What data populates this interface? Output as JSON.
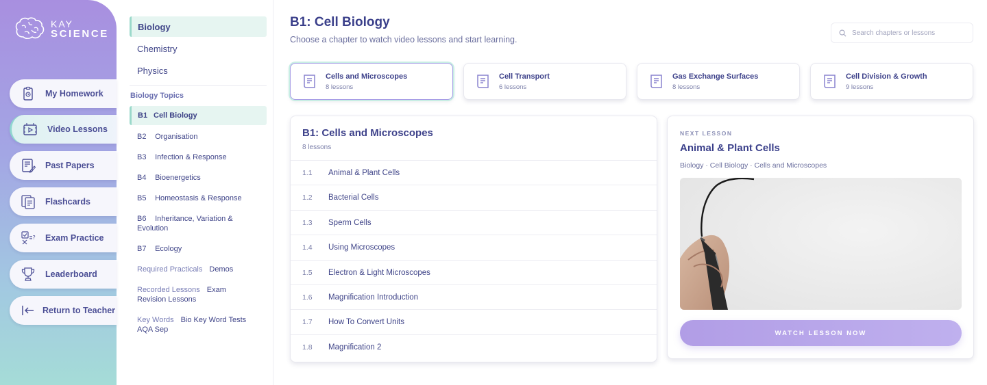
{
  "brand": {
    "line1": "KAY",
    "line2": "SCIENCE"
  },
  "nav": [
    {
      "label": "My Homework",
      "icon": "homework-icon"
    },
    {
      "label": "Video Lessons",
      "icon": "video-lessons-icon"
    },
    {
      "label": "Past Papers",
      "icon": "past-papers-icon"
    },
    {
      "label": "Flashcards",
      "icon": "flashcards-icon"
    },
    {
      "label": "Exam Practice",
      "icon": "exam-practice-icon"
    },
    {
      "label": "Leaderboard",
      "icon": "trophy-icon"
    },
    {
      "label": "Return to Teacher",
      "icon": "return-arrow-icon"
    }
  ],
  "nav_active": "Video Lessons",
  "subjects": [
    "Biology",
    "Chemistry",
    "Physics"
  ],
  "subject_active": "Biology",
  "topics_title": "Biology Topics",
  "topics": [
    {
      "code": "B1",
      "label": "Cell Biology"
    },
    {
      "code": "B2",
      "label": "Organisation"
    },
    {
      "code": "B3",
      "label": "Infection & Response"
    },
    {
      "code": "B4",
      "label": "Bioenergetics"
    },
    {
      "code": "B5",
      "label": "Homeostasis & Response"
    },
    {
      "code": "B6",
      "label": "Inheritance, Variation & Evolution"
    },
    {
      "code": "B7",
      "label": "Ecology"
    }
  ],
  "extra_links": [
    {
      "prefix": "Required Practicals",
      "label": "Demos"
    },
    {
      "prefix": "Recorded Lessons",
      "label": "Exam Revision Lessons"
    },
    {
      "prefix": "Key Words",
      "label": "Bio Key Word Tests AQA Sep"
    }
  ],
  "main": {
    "title": "B1: Cell Biology",
    "subtitle": "Choose a chapter to watch video lessons and start learning.",
    "search_placeholder": "Search chapters or lessons"
  },
  "chapters": [
    {
      "title": "Cells and Microscopes",
      "count": "8 lessons"
    },
    {
      "title": "Cell Transport",
      "count": "6 lessons"
    },
    {
      "title": "Gas Exchange Surfaces",
      "count": "8 lessons"
    },
    {
      "title": "Cell Division & Growth",
      "count": "9 lessons"
    }
  ],
  "lesson_list": {
    "title": "B1: Cells and Microscopes",
    "count": "8 lessons",
    "lessons": [
      {
        "num": "1.1",
        "title": "Animal & Plant Cells"
      },
      {
        "num": "1.2",
        "title": "Bacterial Cells"
      },
      {
        "num": "1.3",
        "title": "Sperm Cells"
      },
      {
        "num": "1.4",
        "title": "Using Microscopes"
      },
      {
        "num": "1.5",
        "title": "Electron & Light Microscopes"
      },
      {
        "num": "1.6",
        "title": "Magnification Introduction"
      },
      {
        "num": "1.7",
        "title": "How To Convert Units"
      },
      {
        "num": "1.8",
        "title": "Magnification 2"
      }
    ]
  },
  "next_lesson": {
    "label": "NEXT LESSON",
    "title": "Animal & Plant Cells",
    "breadcrumb": "Biology · Cell Biology · Cells and Microscopes",
    "button": "WATCH LESSON NOW"
  },
  "colors": {
    "accent": "#a89ee6",
    "active_bg": "#e6f5f1",
    "text_dark": "#3a3f8a"
  }
}
